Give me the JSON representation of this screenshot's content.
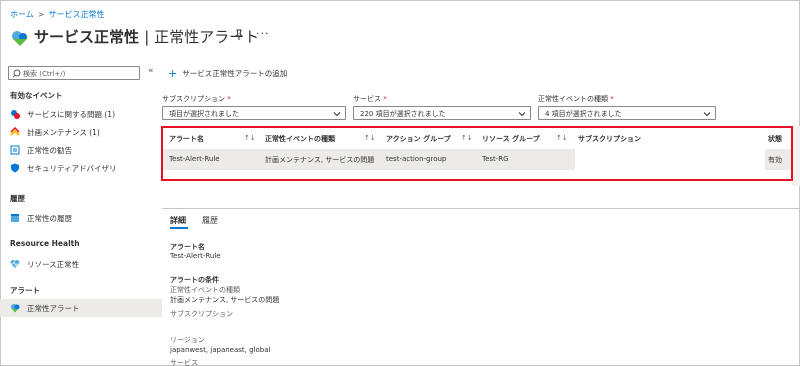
{
  "breadcrumb": {
    "home": "ホーム",
    "current": "サービス正常性",
    "sep": ">"
  },
  "header": {
    "title_main": "サービス正常性",
    "title_sub": "| 正常性アラート",
    "more": "···"
  },
  "sidebar": {
    "search_placeholder": "検索 (Ctrl+/)",
    "collapse": "«",
    "sections": {
      "events": "有効なイベント",
      "history": "履歴",
      "resource_health": "Resource Health",
      "alerts": "アラート"
    },
    "items": {
      "service_issues": "サービスに関する問題 (1)",
      "planned_maintenance": "計画メンテナンス (1)",
      "health_advisories": "正常性の勧告",
      "security_advisories": "セキュリティアドバイザリ",
      "health_history": "正常性の履歴",
      "resource_health": "リソース正常性",
      "health_alerts": "正常性アラート"
    }
  },
  "toolbar": {
    "add_alert": "サービス正常性アラートの追加",
    "plus": "+"
  },
  "filters": {
    "subscription": {
      "label": "サブスクリプション",
      "value": "項目が選択されました"
    },
    "service": {
      "label": "サービス",
      "value": "220 項目が選択されました"
    },
    "event_type": {
      "label": "正常性イベントの種類",
      "value": "4 項目が選択されました"
    },
    "required_mark": "*"
  },
  "table": {
    "columns": [
      "アラート名",
      "正常性イベントの種類",
      "アクション グループ",
      "リソース グループ",
      "サブスクリプション",
      "状態"
    ],
    "sort_glyph": "↑↓",
    "rows": [
      {
        "name": "Test-Alert-Rule",
        "event_type": "計画メンテナンス, サービスの問題",
        "action_group": "test-action-group",
        "resource_group": "Test-RG",
        "subscription": "",
        "status": "有効"
      }
    ]
  },
  "details": {
    "tabs": [
      "詳細",
      "履歴"
    ],
    "alert_name_label": "アラート名",
    "alert_name_value": "Test-Alert-Rule",
    "conditions_label": "アラートの条件",
    "event_type_sublabel": "正常性イベントの種類",
    "event_type_value": "計画メンテナンス, サービスの問題",
    "subscription_sublabel": "サブスクリプション",
    "region_sublabel": "リージョン",
    "region_value": "japanwest, japaneast, global",
    "service_sublabel": "サービス"
  },
  "colors": {
    "accent": "#0078d4",
    "highlight": "#e81123",
    "selected_row": "#edebe9"
  }
}
